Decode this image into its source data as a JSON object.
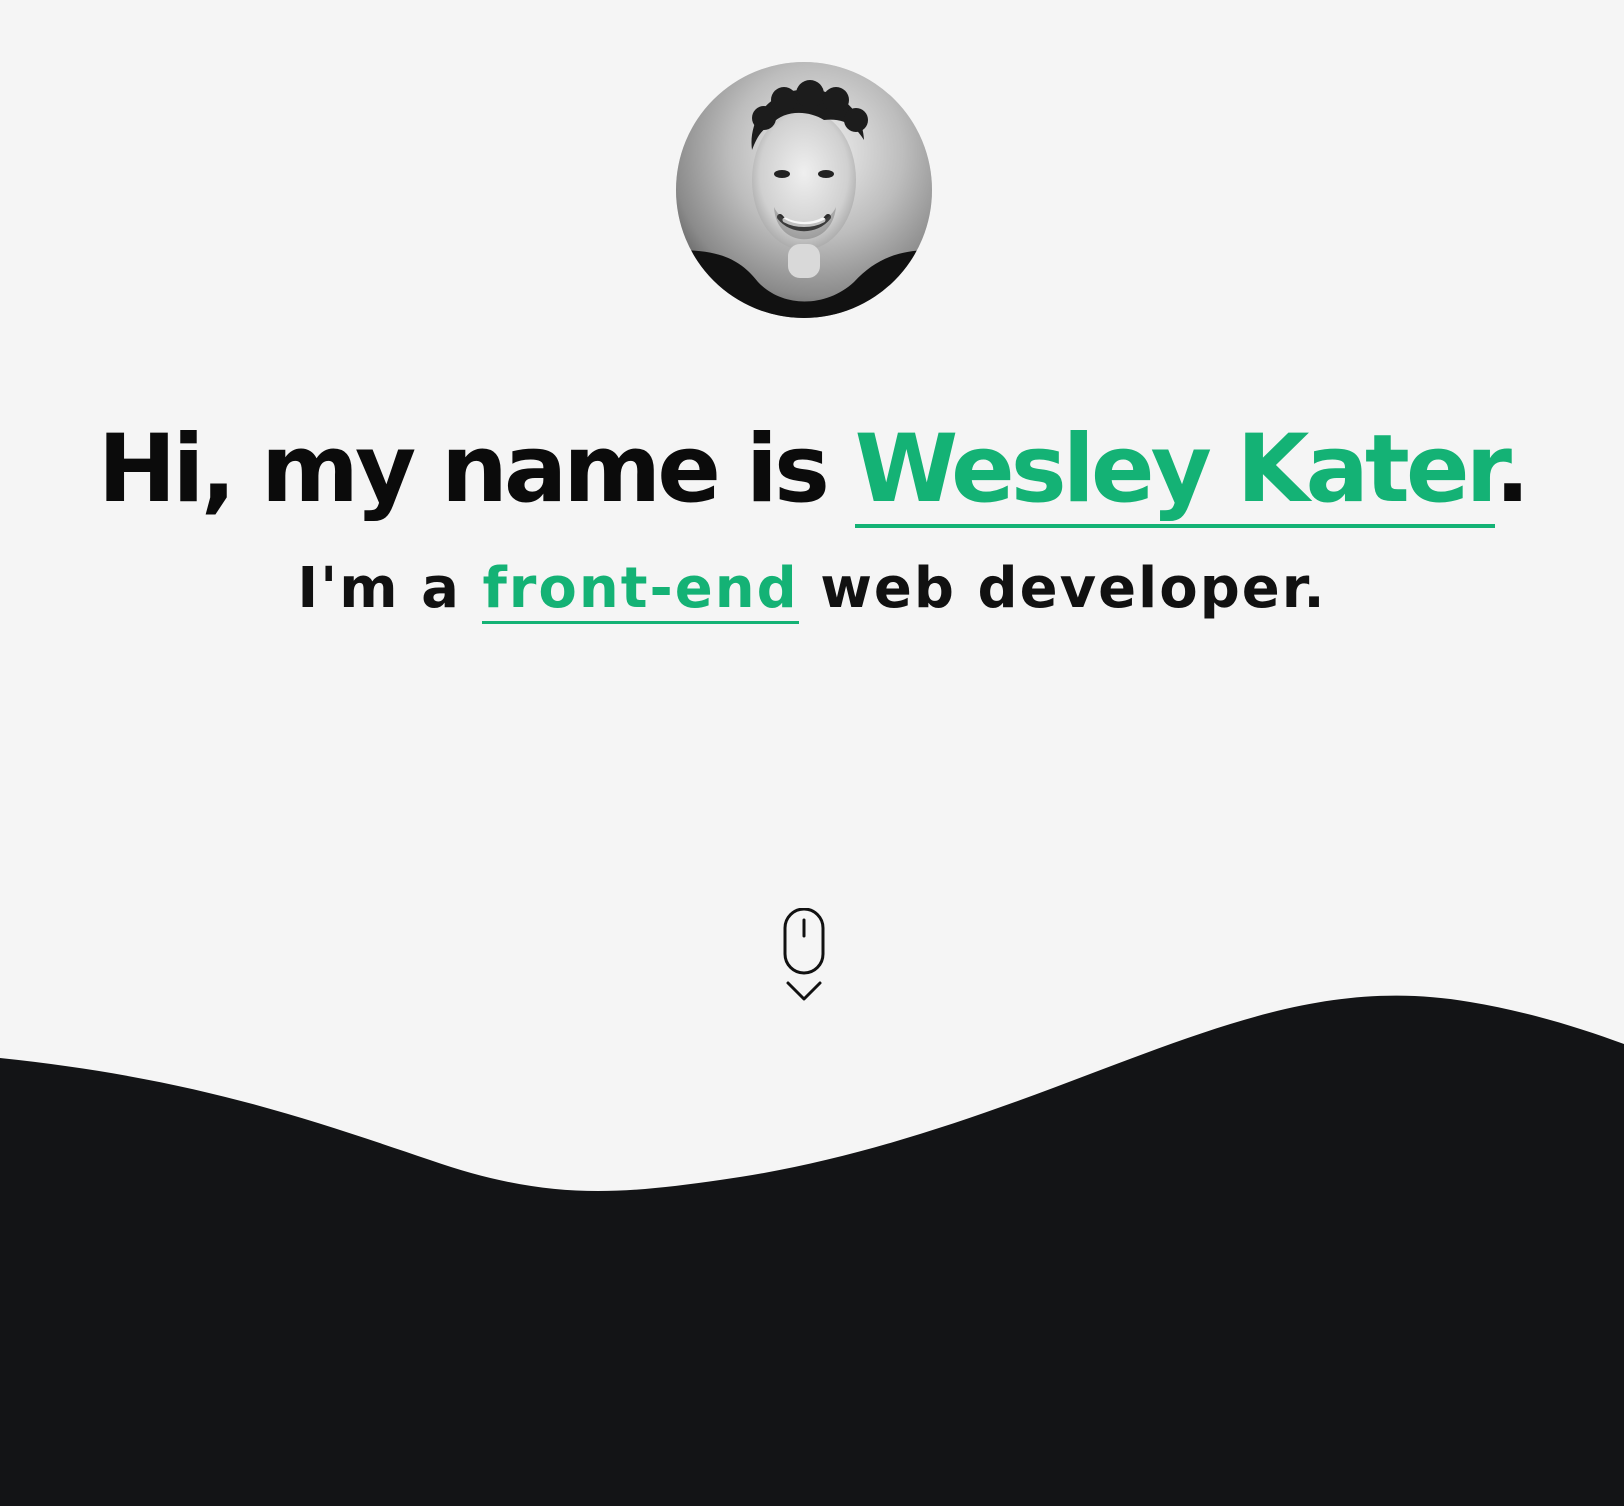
{
  "hero": {
    "headline_prefix": "Hi, my name is ",
    "name": "Wesley Kater",
    "headline_suffix": ".",
    "subline_prefix": "I'm a ",
    "role": "front-end",
    "subline_suffix": " web developer."
  },
  "icons": {
    "avatar": "profile-photo",
    "scroll": "mouse-scroll-down-icon"
  },
  "colors": {
    "background": "#f5f5f5",
    "accent": "#14b275",
    "text": "#0b0b0b",
    "wave": "#131416"
  }
}
